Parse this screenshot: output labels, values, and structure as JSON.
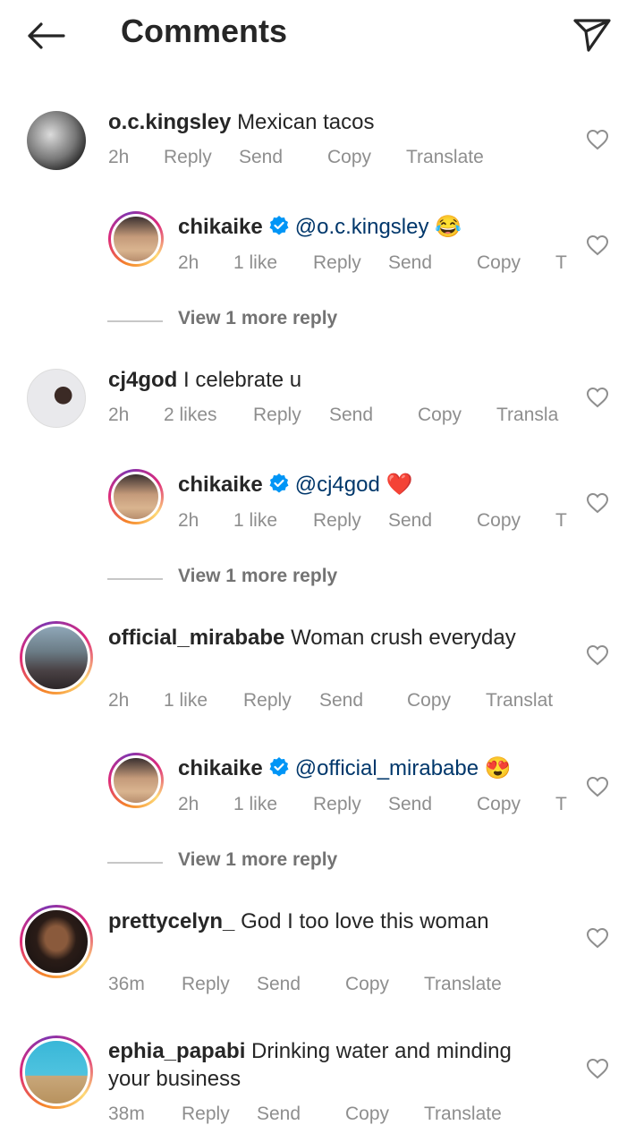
{
  "header": {
    "title": "Comments",
    "back_icon": "arrow-left-icon",
    "share_icon": "paper-plane-icon"
  },
  "comments": [
    {
      "username": "o.c.kingsley",
      "text": "Mexican tacos",
      "time": "2h",
      "likes": "",
      "actions": [
        "Reply",
        "Send",
        "Copy",
        "Translate"
      ]
    },
    {
      "username": "chikaike",
      "mention": "@o.c.kingsley",
      "emoji": "😂",
      "time": "2h",
      "likes": "1 like",
      "actions": [
        "Reply",
        "Send",
        "Copy",
        "T"
      ]
    },
    {
      "username": "cj4god",
      "text": "I celebrate u",
      "time": "2h",
      "likes": "2 likes",
      "actions": [
        "Reply",
        "Send",
        "Copy",
        "Transla"
      ]
    },
    {
      "username": "chikaike",
      "mention": "@cj4god",
      "emoji": "❤️",
      "time": "2h",
      "likes": "1 like",
      "actions": [
        "Reply",
        "Send",
        "Copy",
        "T"
      ]
    },
    {
      "username": "official_mirababe",
      "text": "Woman crush everyday",
      "time": "2h",
      "likes": "1 like",
      "actions": [
        "Reply",
        "Send",
        "Copy",
        "Translat"
      ]
    },
    {
      "username": "chikaike",
      "mention": "@official_mirababe",
      "emoji": "😍",
      "time": "2h",
      "likes": "1 like",
      "actions": [
        "Reply",
        "Send",
        "Copy",
        "T"
      ]
    },
    {
      "username": "prettycelyn_",
      "text": "God I too love this woman",
      "time": "36m",
      "likes": "",
      "actions": [
        "Reply",
        "Send",
        "Copy",
        "Translate"
      ]
    },
    {
      "username": "ephia_papabi",
      "text": "Drinking water and minding",
      "text2": "your business",
      "time": "38m",
      "likes": "",
      "actions": [
        "Reply",
        "Send",
        "Copy",
        "Translate"
      ]
    }
  ],
  "view_more": "View 1 more reply",
  "colors": {
    "text": "#262626",
    "meta": "#8e8e8e",
    "mention": "#00376b",
    "verified": "#0095f6"
  }
}
